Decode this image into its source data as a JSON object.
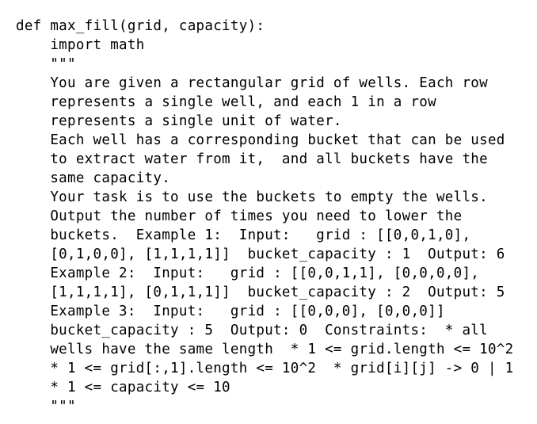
{
  "code": {
    "lines": [
      "def max_fill(grid, capacity):",
      "    import math",
      "    \"\"\"",
      "    You are given a rectangular grid of wells. Each row",
      "    represents a single well, and each 1 in a row",
      "    represents a single unit of water.",
      "    Each well has a corresponding bucket that can be used",
      "    to extract water from it,  and all buckets have the",
      "    same capacity.",
      "    Your task is to use the buckets to empty the wells.",
      "    Output the number of times you need to lower the",
      "    buckets.  Example 1:  Input:   grid : [[0,0,1,0],",
      "    [0,1,0,0], [1,1,1,1]]  bucket_capacity : 1  Output: 6",
      "    Example 2:  Input:   grid : [[0,0,1,1], [0,0,0,0],",
      "    [1,1,1,1], [0,1,1,1]]  bucket_capacity : 2  Output: 5",
      "    Example 3:  Input:   grid : [[0,0,0], [0,0,0]]",
      "    bucket_capacity : 5  Output: 0  Constraints:  * all",
      "    wells have the same length  * 1 <= grid.length <= 10^2",
      "    * 1 <= grid[:,1].length <= 10^2  * grid[i][j] -> 0 | 1",
      "    * 1 <= capacity <= 10",
      "    \"\"\""
    ]
  }
}
